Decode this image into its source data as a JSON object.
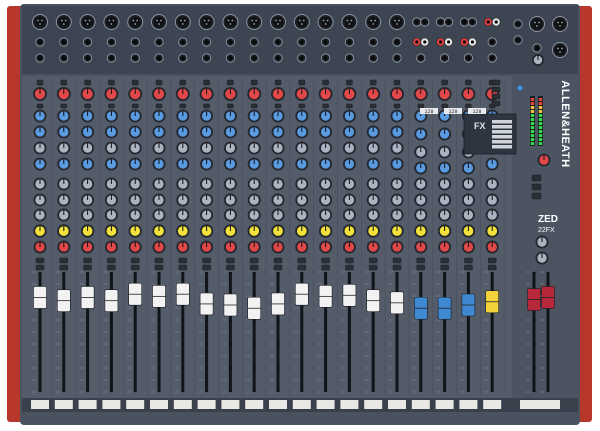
{
  "device": {
    "brand": "ALLEN&HEATH",
    "model_name": "ZED",
    "model_variant": "22FX",
    "fx_logo": "FX",
    "fx_preset_labels": [
      "128",
      "128",
      "128"
    ]
  },
  "layout_counts": {
    "mono_channels": 16,
    "stereo_channels": 3,
    "fx_return_channels": 1,
    "master_faders": 2
  },
  "colors": {
    "chassis": "#4a5260",
    "panel": "#545c6a",
    "side_cheek": "#c23a2e",
    "fader_cap_mono": "#f2f2f2",
    "fader_cap_stereo": "#3f88d2",
    "fader_cap_fx": "#f2d23a",
    "fader_cap_master": "#b7283b",
    "knob_blue": "#5a9ae0",
    "knob_yellow": "#f3e23c",
    "knob_red": "#e0484a",
    "meter_led": "#35d84a"
  },
  "fader_levels": {
    "mono": [
      0.82,
      0.79,
      0.82,
      0.79,
      0.85,
      0.83,
      0.85,
      0.76,
      0.75,
      0.72,
      0.76,
      0.85,
      0.83,
      0.84,
      0.79,
      0.77
    ],
    "stereo": [
      0.72,
      0.72,
      0.75
    ],
    "fx_return": 0.78,
    "master": [
      0.8,
      0.82
    ]
  }
}
